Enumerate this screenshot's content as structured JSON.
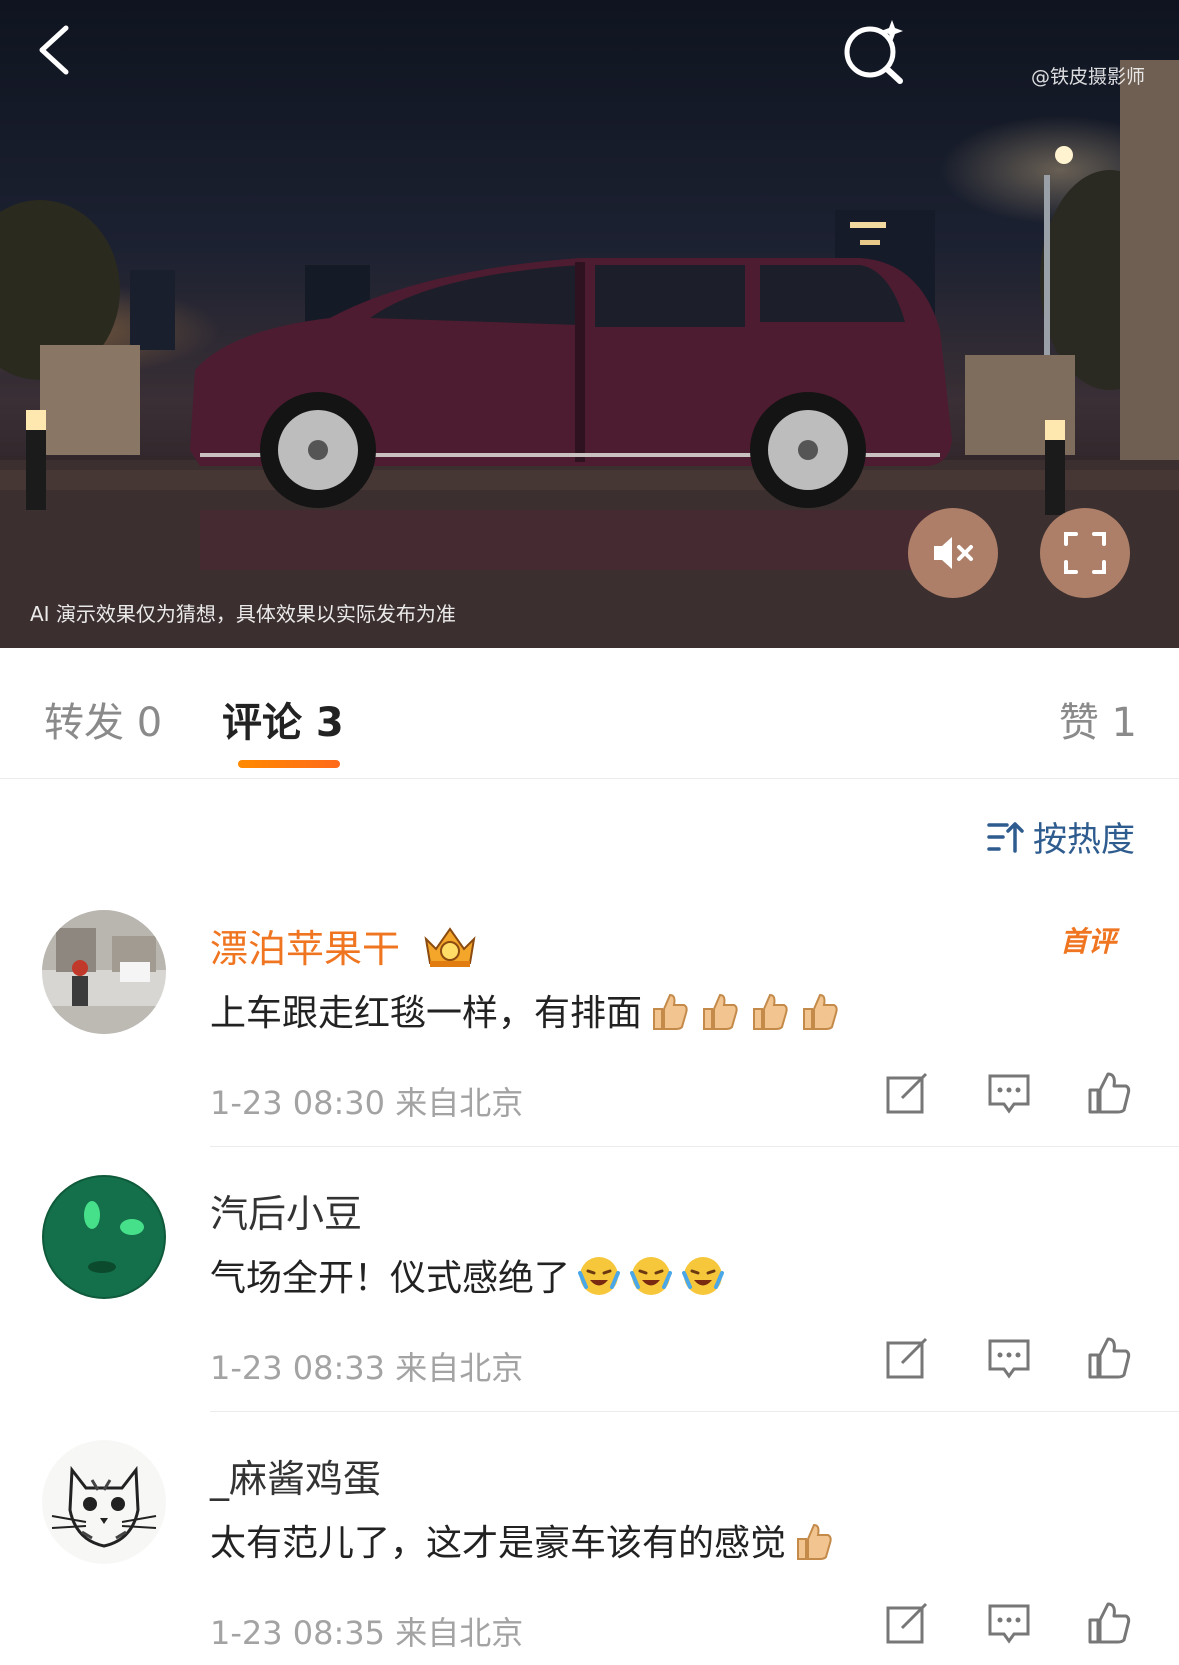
{
  "video": {
    "watermark": "@铁皮摄影师",
    "disclaimer": "AI 演示效果仅为猜想，具体效果以实际发布为准"
  },
  "tabs": {
    "repost": "转发 0",
    "comment": "评论 3",
    "like": "赞 1"
  },
  "sort": {
    "label": "按热度"
  },
  "comments": [
    {
      "username": "漂泊苹果干",
      "badge": "首评",
      "text": "上车跟走红毯一样，有排面",
      "emoji": "thumbs-up",
      "time": "1-23 08:30",
      "location": "来自北京"
    },
    {
      "username": "汽后小豆",
      "text": "气场全开！仪式感绝了",
      "emoji": "laughing-crying",
      "time": "1-23 08:33",
      "location": "来自北京"
    },
    {
      "username": "_麻酱鸡蛋",
      "text": "太有范儿了，这才是豪车该有的感觉",
      "emoji": "thumbs-up",
      "time": "1-23 08:35",
      "location": "来自北京"
    }
  ],
  "colors": {
    "accent": "#f07520",
    "sort_blue": "#2f5c8f",
    "meta_gray": "#a3a3a3"
  }
}
